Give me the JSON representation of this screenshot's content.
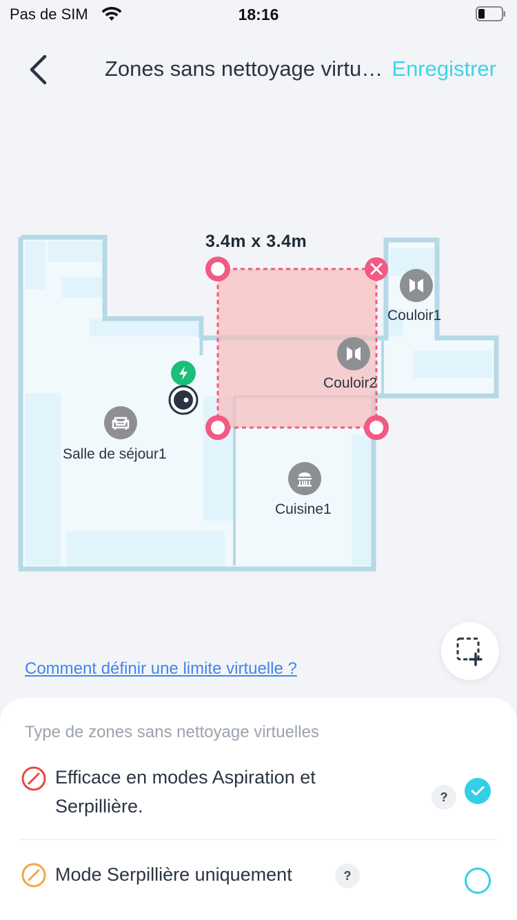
{
  "status_bar": {
    "carrier": "Pas de SIM",
    "time": "18:16",
    "icons": [
      "wifi-icon",
      "battery-icon"
    ]
  },
  "header": {
    "title": "Zones sans nettoyage virtuelles",
    "save_label": "Enregistrer",
    "back_icon": "chevron-left-icon"
  },
  "map": {
    "zone_size": "3.4m x 3.4m",
    "rooms": [
      {
        "label": "Couloir1",
        "icon": "door-icon"
      },
      {
        "label": "Couloir2",
        "icon": "door-icon"
      },
      {
        "label": "Salle de séjour1",
        "icon": "sofa-icon"
      },
      {
        "label": "Cuisine1",
        "icon": "kitchen-icon"
      }
    ],
    "dock_icon": "charging-icon",
    "robot_icon": "robot-icon"
  },
  "help_link": "Comment définir une limite virtuelle ?",
  "sheet": {
    "section_title": "Type de zones sans nettoyage virtuelles",
    "options": [
      {
        "label": "Efficace en modes Aspiration et Serpillière.",
        "icon": "no-entry-icon",
        "selected": true
      },
      {
        "label": "Mode Serpillière uniquement",
        "icon": "no-entry-icon",
        "selected": false
      }
    ]
  },
  "colors": {
    "accent": "#33cfe4",
    "link": "#3f86e8",
    "zone_fill": "#f6bcbd",
    "zone_border": "#f25a83",
    "option1_icon": "#e9473b",
    "option2_icon": "#f3a447",
    "dock": "#1bbf7a"
  }
}
